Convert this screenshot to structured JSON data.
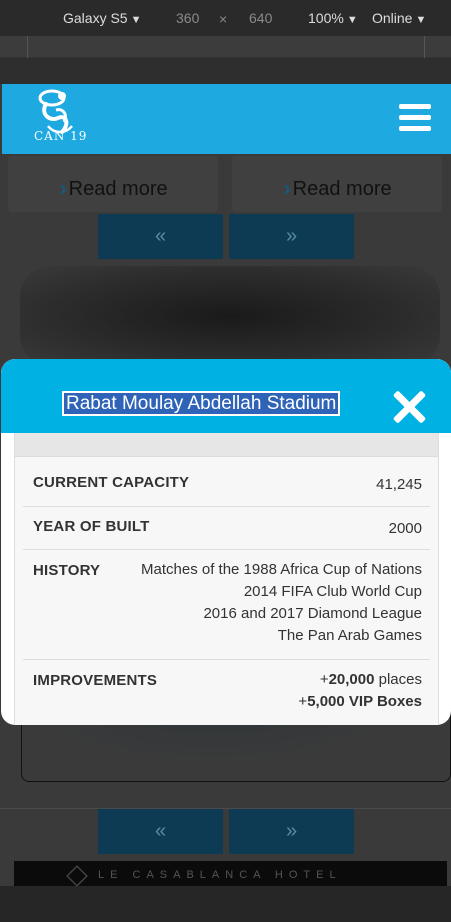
{
  "devtools": {
    "device": "Galaxy S5",
    "width": "360",
    "times": "×",
    "height": "640",
    "zoom": "100%",
    "network": "Online",
    "caret": "▼"
  },
  "site": {
    "logo_text": "CAN 19",
    "read_more": "Read more",
    "read_more_chevron": "›",
    "prev": "«",
    "next": "»",
    "hotel_text": "LE CASABLANCA HOTEL",
    "header_color": "#1fa9e1"
  },
  "modal": {
    "title": "Rabat Moulay Abdellah Stadium",
    "header_color": "#00b2e3",
    "rows": [
      {
        "label": "CURRENT CAPACITY",
        "value": "41,245"
      },
      {
        "label": "YEAR OF BUILT",
        "value": "2000"
      },
      {
        "label": "HISTORY",
        "lines": [
          "Matches of the 1988 Africa Cup of Nations",
          "2014 FIFA Club World Cup",
          "2016 and 2017 Diamond League",
          "The Pan Arab Games"
        ]
      },
      {
        "label": "IMPROVEMENTS",
        "lines": [
          {
            "prefix": "+",
            "bold": "20,000",
            "suffix": " places"
          },
          {
            "prefix": "+",
            "bold": "5,000 VIP Boxes",
            "suffix": ""
          }
        ]
      }
    ]
  }
}
